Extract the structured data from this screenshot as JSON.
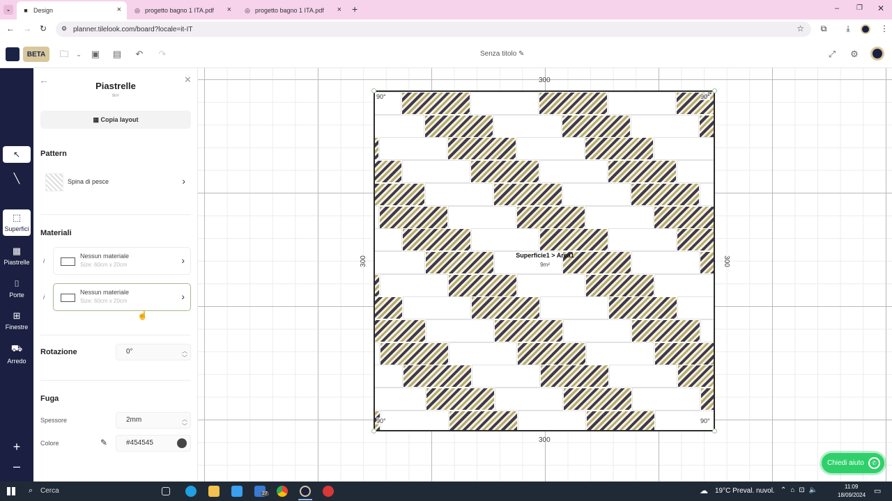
{
  "browser": {
    "tabs": [
      {
        "label": "Design",
        "active": true
      },
      {
        "label": "progetto bagno 1 ITA.pdf",
        "active": false
      },
      {
        "label": "progetto bagno 1 ITA.pdf",
        "active": false
      }
    ],
    "url": "planner.tilelook.com/board?locale=it-IT"
  },
  "header": {
    "beta_label": "BETA",
    "doc_title": "Senza titolo"
  },
  "rail": {
    "items": [
      {
        "label": "Superfici",
        "icon": "surface-icon"
      },
      {
        "label": "Piastrelle",
        "icon": "tiles-icon"
      },
      {
        "label": "Porte",
        "icon": "door-icon"
      },
      {
        "label": "Finestre",
        "icon": "window-icon"
      },
      {
        "label": "Arredo",
        "icon": "sofa-icon"
      }
    ]
  },
  "panel": {
    "title": "Piastrelle",
    "subtitle": "9m²",
    "copy_layout": "Copia layout",
    "pattern_heading": "Pattern",
    "pattern_value": "Spina di pesce",
    "materials_heading": "Materiali",
    "materials": [
      {
        "title": "Nessun materiale",
        "size": "Size: 60cm x 20cm",
        "info": "i"
      },
      {
        "title": "Nessun materiale",
        "size": "Size: 60cm x 20cm",
        "info": "i"
      }
    ],
    "rotation_heading": "Rotazione",
    "rotation_value": "0°",
    "grout_heading": "Fuga",
    "thickness_label": "Spessore",
    "thickness_value": "2mm",
    "color_label": "Colore",
    "color_value": "#454545"
  },
  "canvas": {
    "dim_top": "300",
    "dim_bottom": "300",
    "dim_left": "300",
    "dim_right": "300",
    "angles": [
      "90°",
      "90°",
      "90°",
      "90°"
    ],
    "area_label": "Superficie1 > Area1",
    "area_sub": "9m²",
    "help_button": "Chiedi aiuto"
  },
  "taskbar": {
    "search": "Cerca",
    "weather": "19°C  Preval. nuvol.",
    "time": "11:09",
    "date": "18/09/2024",
    "mail_badge": "27"
  },
  "colors": {
    "rail_bg": "#1b2042",
    "beta_bg": "#d8c79a",
    "accent_green": "#2fd06b",
    "grout": "#454545"
  }
}
